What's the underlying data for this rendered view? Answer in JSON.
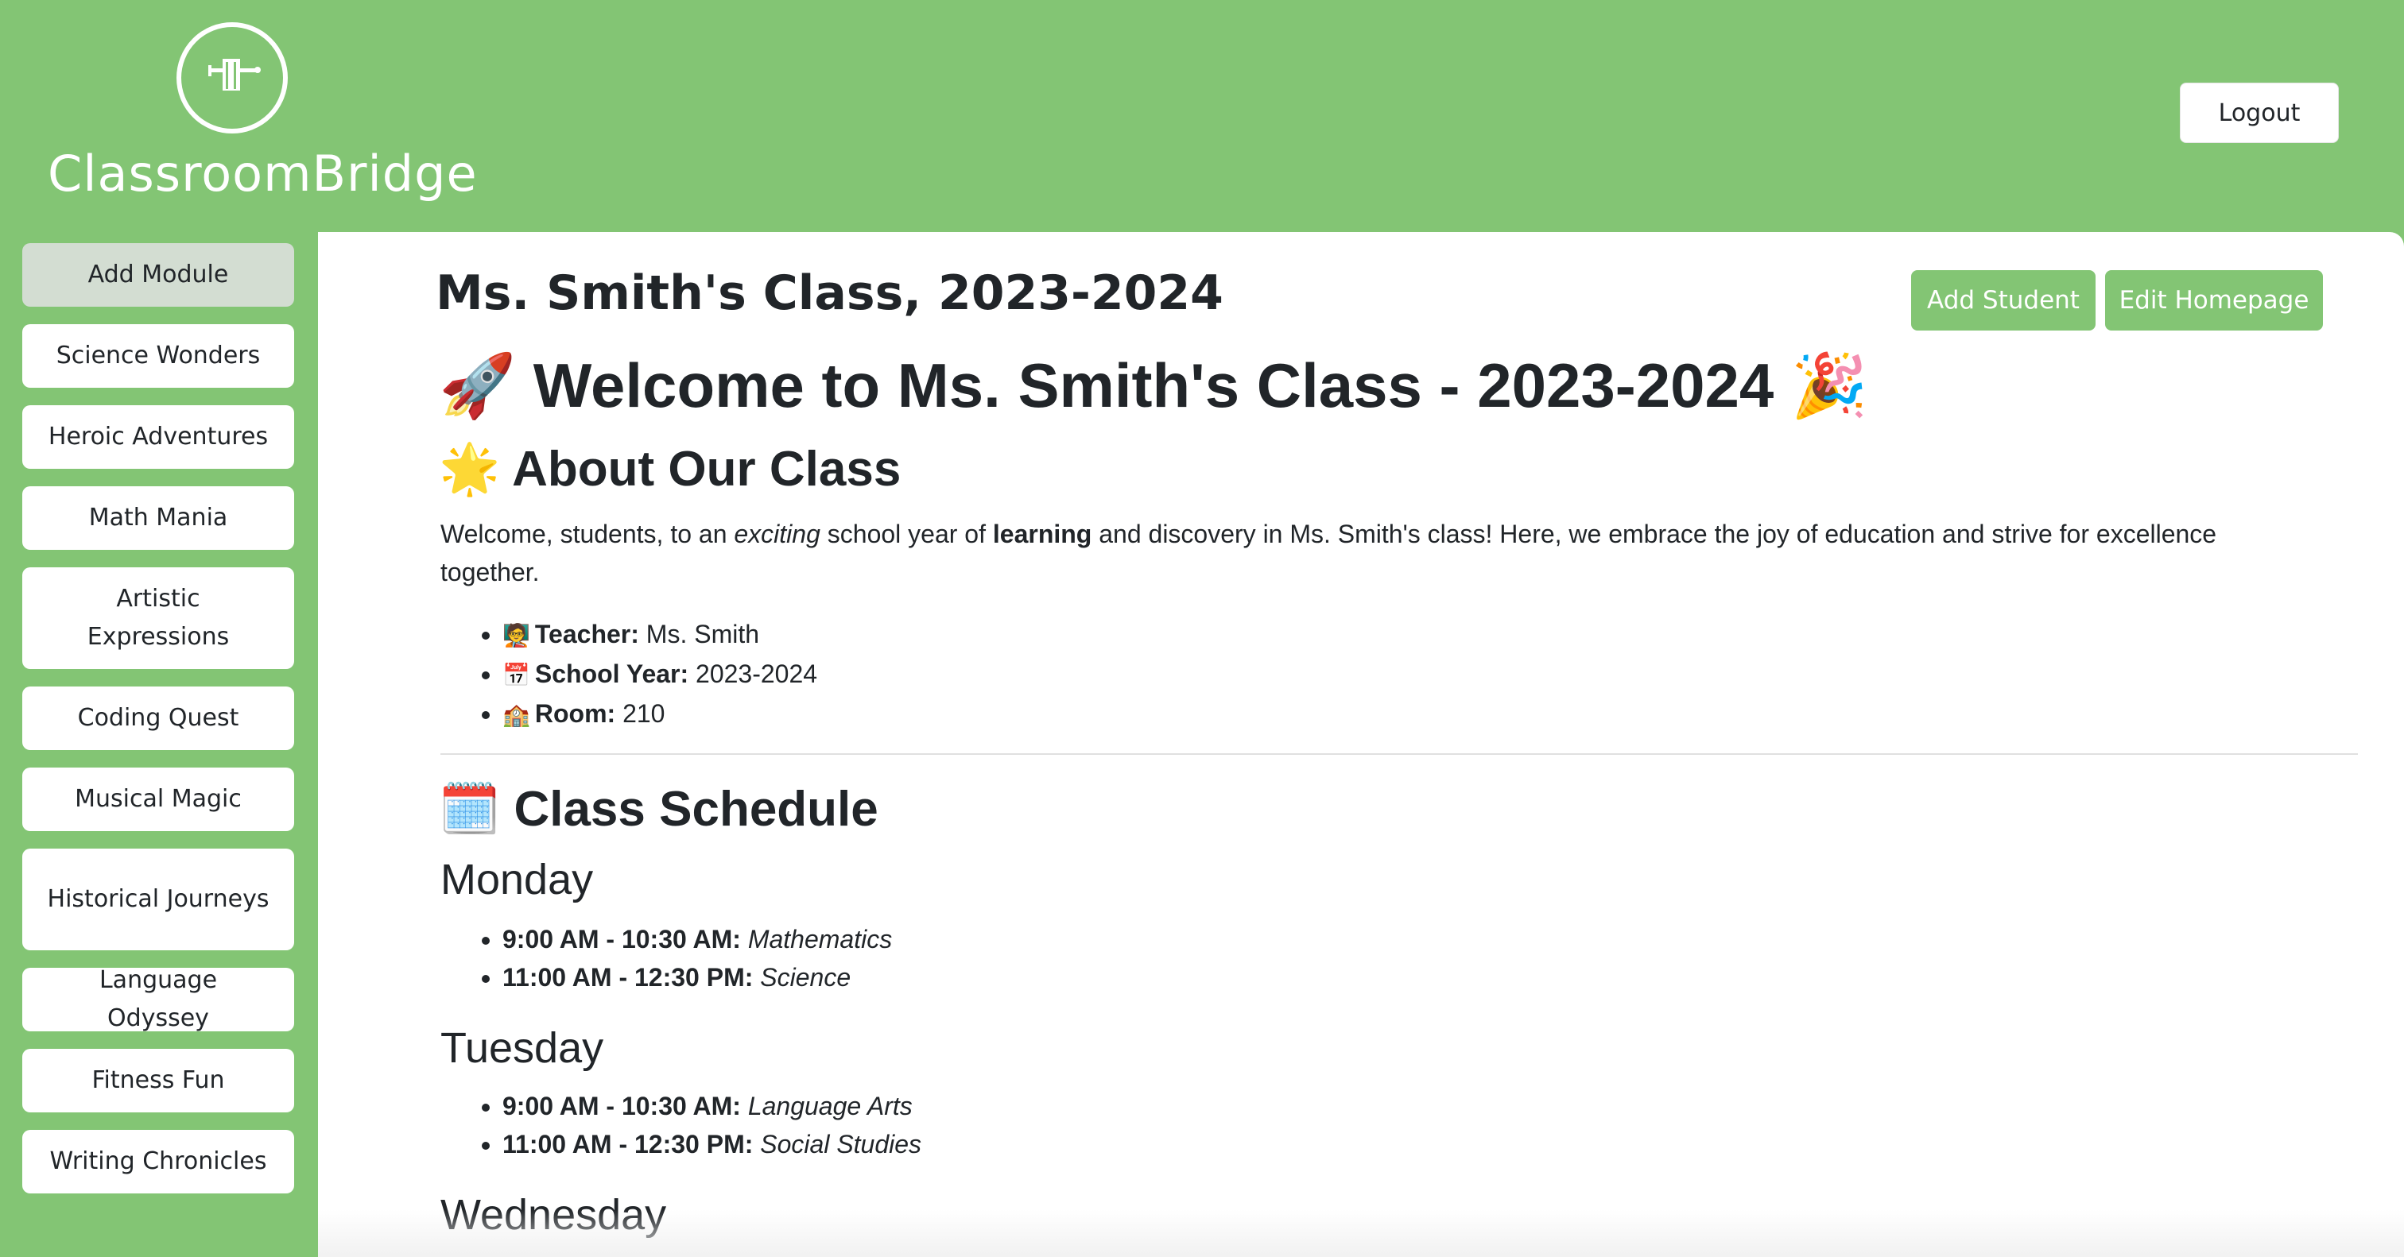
{
  "app": {
    "brand": "ClassroomBridge",
    "logo_icon": "bridge-icon",
    "logout_label": "Logout"
  },
  "sidebar": {
    "add_module_label": "Add Module",
    "items": [
      {
        "label": "Science Wonders"
      },
      {
        "label": "Heroic Adventures"
      },
      {
        "label": "Math Mania"
      },
      {
        "label": "Artistic Expressions"
      },
      {
        "label": "Coding Quest"
      },
      {
        "label": "Musical Magic"
      },
      {
        "label": "Historical Journeys"
      },
      {
        "label": "Language Odyssey"
      },
      {
        "label": "Fitness Fun"
      },
      {
        "label": "Writing Chronicles"
      }
    ]
  },
  "main": {
    "page_title": "Ms. Smith's Class, 2023-2024",
    "add_student_label": "Add Student",
    "edit_homepage_label": "Edit Homepage",
    "welcome_emoji_left": "🚀",
    "welcome_text": "Welcome to Ms. Smith's Class - 2023-2024",
    "welcome_emoji_right": "🎉",
    "about_emoji": "🌟",
    "about_heading": "About Our Class",
    "intro": {
      "part1": "Welcome, students, to an ",
      "italic": "exciting",
      "part2": " school year of ",
      "bold": "learning",
      "part3": " and discovery in Ms. Smith's class! Here, we embrace the joy of education and strive for excellence together."
    },
    "facts": [
      {
        "emoji": "🧑‍🏫",
        "label": "Teacher:",
        "value": "Ms. Smith"
      },
      {
        "emoji": "📅",
        "label": "School Year:",
        "value": "2023-2024"
      },
      {
        "emoji": "🏫",
        "label": "Room:",
        "value": "210"
      }
    ],
    "schedule_emoji": "🗓️",
    "schedule_heading": "Class Schedule",
    "days": [
      {
        "name": "Monday",
        "slots": [
          {
            "time": "9:00 AM - 10:30 AM:",
            "subject": "Mathematics"
          },
          {
            "time": "11:00 AM - 12:30 PM:",
            "subject": "Science"
          }
        ]
      },
      {
        "name": "Tuesday",
        "slots": [
          {
            "time": "9:00 AM - 10:30 AM:",
            "subject": "Language Arts"
          },
          {
            "time": "11:00 AM - 12:30 PM:",
            "subject": "Social Studies"
          }
        ]
      },
      {
        "name": "Wednesday",
        "slots": []
      }
    ]
  },
  "colors": {
    "brand_green": "#83c574",
    "add_module_bg": "#d3ddd2",
    "text": "#212529"
  }
}
